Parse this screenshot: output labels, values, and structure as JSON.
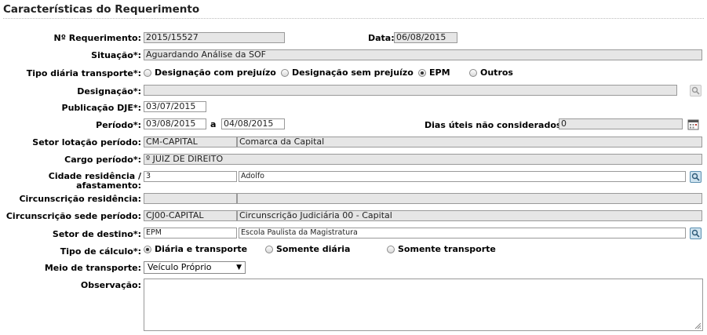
{
  "section_title": "Características do Requerimento",
  "fields": {
    "numero": {
      "label": "Nº Requerimento:",
      "value": "2015/15527"
    },
    "data": {
      "label": "Data:",
      "value": "06/08/2015"
    },
    "situacao": {
      "label": "Situação*:",
      "value": "Aguardando Análise da SOF"
    },
    "tipo_diaria": {
      "label": "Tipo diária transporte*:",
      "options": [
        "Designação com prejuízo",
        "Designação sem prejuízo",
        "EPM",
        "Outros"
      ],
      "selected": "EPM"
    },
    "designacao": {
      "label": "Designação*:",
      "value": ""
    },
    "publicacao": {
      "label": "Publicação DJE*:",
      "value": "03/07/2015"
    },
    "periodo": {
      "label": "Período*:",
      "start": "03/08/2015",
      "separator": "a",
      "end": "04/08/2015"
    },
    "dias_uteis": {
      "label": "Dias úteis não considerados*:",
      "value": "0"
    },
    "setor_lotacao": {
      "label": "Setor lotação período:",
      "code": "CM-CAPITAL",
      "name": "Comarca da Capital"
    },
    "cargo": {
      "label": "Cargo período*:",
      "value": "º JUIZ DE DIREITO"
    },
    "cidade": {
      "label": "Cidade residência / afastamento:",
      "code": "3",
      "name": "Adolfo"
    },
    "circ_residencia": {
      "label": "Circunscrição residência:",
      "code": "",
      "name": ""
    },
    "circ_sede": {
      "label": "Circunscrição sede período:",
      "code": "CJ00-CAPITAL",
      "name": "Circunscrição Judiciária 00 - Capital"
    },
    "setor_destino": {
      "label": "Setor de destino*:",
      "code": "EPM",
      "name": "Escola Paulista da Magistratura"
    },
    "tipo_calculo": {
      "label": "Tipo de cálculo*:",
      "options": [
        "Diária e transporte",
        "Somente diária",
        "Somente transporte"
      ],
      "selected": "Diária e transporte"
    },
    "meio_transporte": {
      "label": "Meio de transporte:",
      "value": "Veículo Próprio"
    },
    "observacao": {
      "label": "Observação:",
      "value": ""
    }
  },
  "icons": {
    "designacao_lookup": "magnifier-icon",
    "calendar": "calendar-icon",
    "cidade_lookup": "magnifier-icon",
    "setor_lookup": "magnifier-icon"
  },
  "colors": {
    "readonly_bg": "#e6e6e6",
    "lookup_blue": "#5b8fb0"
  }
}
